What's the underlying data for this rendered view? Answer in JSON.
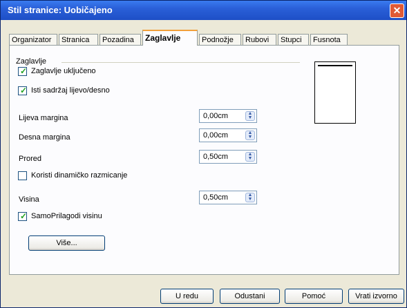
{
  "window": {
    "title": "Stil stranice: Uobičajeno"
  },
  "tabs": [
    {
      "label": "Organizator"
    },
    {
      "label": "Stranica"
    },
    {
      "label": "Pozadina"
    },
    {
      "label": "Zaglavlje"
    },
    {
      "label": "Podnožje"
    },
    {
      "label": "Rubovi"
    },
    {
      "label": "Stupci"
    },
    {
      "label": "Fusnota"
    }
  ],
  "active_tab": "Zaglavlje",
  "section": {
    "title": "Zaglavlje"
  },
  "options": {
    "header_on": {
      "label": "Zaglavlje uključeno",
      "checked": true
    },
    "same_content": {
      "label": "Isti sadržaj lijevo/desno",
      "checked": true
    },
    "dynamic_spacing": {
      "label": "Koristi dinamičko razmicanje",
      "checked": false
    },
    "autofit": {
      "label": "SamoPrilagodi visinu",
      "checked": true
    }
  },
  "fields": {
    "left_margin": {
      "label": "Lijeva margina",
      "value": "0,00cm"
    },
    "right_margin": {
      "label": "Desna margina",
      "value": "0,00cm"
    },
    "spacing": {
      "label": "Prored",
      "value": "0,50cm"
    },
    "height": {
      "label": "Visina",
      "value": "0,50cm"
    }
  },
  "buttons": {
    "more": "Više...",
    "ok": "U redu",
    "cancel": "Odustani",
    "help": "Pomoć",
    "reset": "Vrati izvorno"
  },
  "icons": {
    "close": "close-icon",
    "check": "checkmark-icon",
    "spin": "spin-arrows-icon"
  },
  "colors": {
    "titlebar": "#2a5fd8",
    "active_tab_accent": "#f2a03a",
    "check": "#21a121",
    "dialog_bg": "#ece9d8"
  }
}
